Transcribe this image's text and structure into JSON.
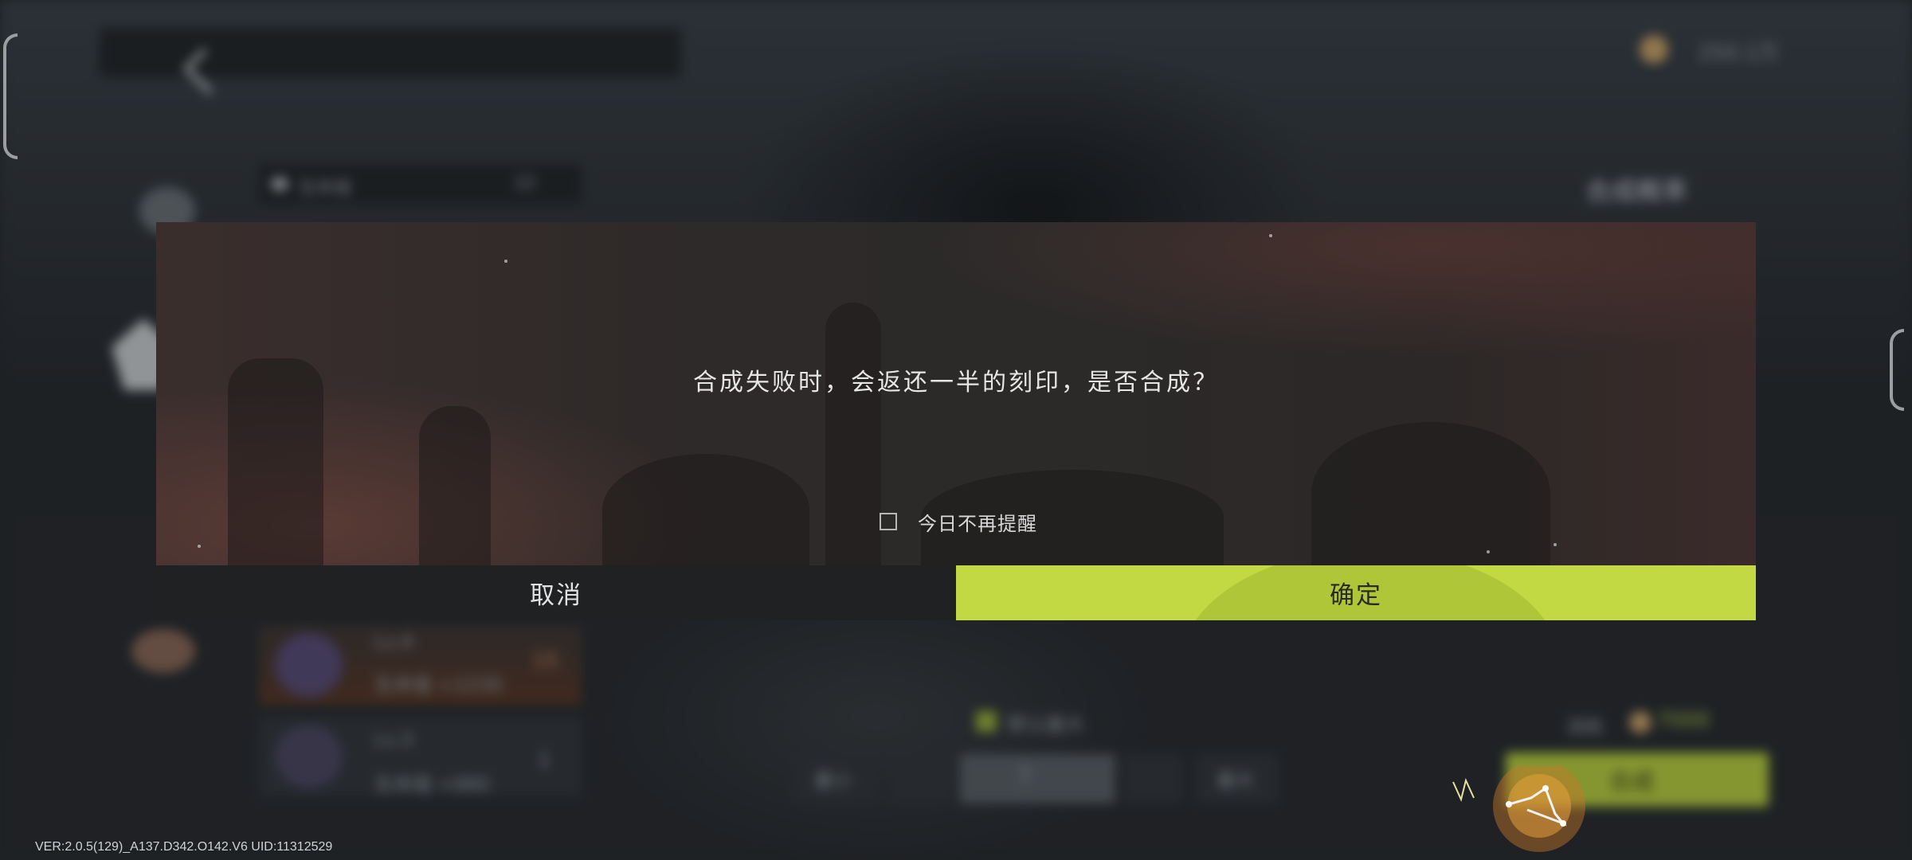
{
  "background": {
    "currency_value": "250.1万",
    "section_label": "生命值",
    "section_count": "22",
    "side_title": "合成概率",
    "items": [
      {
        "level": "Lv.4",
        "stat": "生命值 +1230",
        "count": "15"
      },
      {
        "level": "Lv.3",
        "stat": "生命值 +880",
        "count": "1"
      }
    ],
    "default_check_label": "默认最大",
    "min_button": "最小",
    "max_button": "最大",
    "quantity_value": "7",
    "cost_label": "消耗",
    "cost_value": "7000",
    "synthesize_button": "合成"
  },
  "dialog": {
    "message": "合成失败时，会返还一半的刻印，是否合成？",
    "remind_label": "今日不再提醒",
    "remind_checked": false,
    "cancel_label": "取消",
    "confirm_label": "确定"
  },
  "footer": {
    "version": "VER:2.0.5(129)_A137.D342.O142.V6    UID:11312529"
  },
  "colors": {
    "confirm": "#c2d944",
    "cancel": "#1f2123",
    "synthesize": "#b9d045"
  },
  "icons": [
    "back-arrow-icon",
    "constellation-icon",
    "heart-icon",
    "coin-icon",
    "gem-icon"
  ]
}
